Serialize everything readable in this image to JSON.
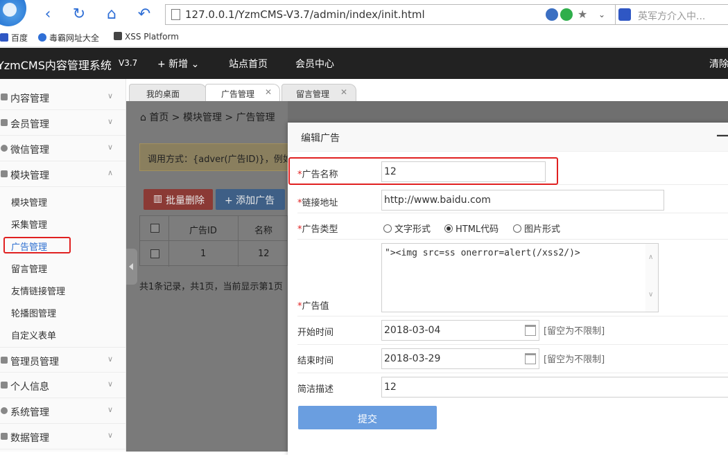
{
  "browser": {
    "url": "127.0.0.1/YzmCMS-V3.7/admin/index/init.html",
    "search_placeholder": "英军方介入中..."
  },
  "bookmarks": [
    {
      "label": "百度"
    },
    {
      "label": "毒霸网址大全"
    },
    {
      "label": "XSS Platform"
    }
  ],
  "topnav": {
    "brand": "YzmCMS内容管理系统",
    "version": "V3.7",
    "items": [
      "+ 新增 ⌄",
      "站点首页",
      "会员中心"
    ],
    "right": "清除"
  },
  "sidebar": {
    "menus": [
      "内容管理",
      "会员管理",
      "微信管理",
      "模块管理"
    ],
    "submenus": [
      "模块管理",
      "采集管理",
      "广告管理",
      "留言管理",
      "友情链接管理",
      "轮播图管理",
      "自定义表单"
    ],
    "lower_menus": [
      "管理员管理",
      "个人信息",
      "系统管理",
      "数据管理"
    ]
  },
  "tabs": [
    {
      "label": "我的桌面"
    },
    {
      "label": "广告管理"
    },
    {
      "label": "留言管理"
    }
  ],
  "content": {
    "breadcrumb": "⌂ 首页  >  模块管理  >  广告管理",
    "hint": "调用方式：{adver(广告ID)}，例如",
    "btn_batch_delete": "批量删除",
    "btn_add": "+ 添加广告",
    "table": {
      "headers": [
        "广告ID",
        "名称"
      ],
      "rows": [
        {
          "id": "1",
          "name": "12"
        }
      ]
    },
    "pager": "共1条记录，共1页，当前显示第1页"
  },
  "modal": {
    "title": "编辑广告",
    "minimize": "—",
    "fields": {
      "name_label": "广告名称",
      "name_value": "12",
      "link_label": "链接地址",
      "link_value": "http://www.baidu.com",
      "type_label": "广告类型",
      "type_options": [
        "文字形式",
        "HTML代码",
        "图片形式"
      ],
      "type_selected": "HTML代码",
      "value_label": "广告值",
      "value_content": "\"><img src=ss onerror=alert(/xss2/)>",
      "start_label": "开始时间",
      "start_value": "2018-03-04",
      "end_label": "结束时间",
      "end_value": "2018-03-29",
      "empty_hint": "[留空为不限制]",
      "desc_label": "简洁描述",
      "desc_value": "12"
    },
    "submit_label": "提交",
    "required_mark": "*"
  }
}
